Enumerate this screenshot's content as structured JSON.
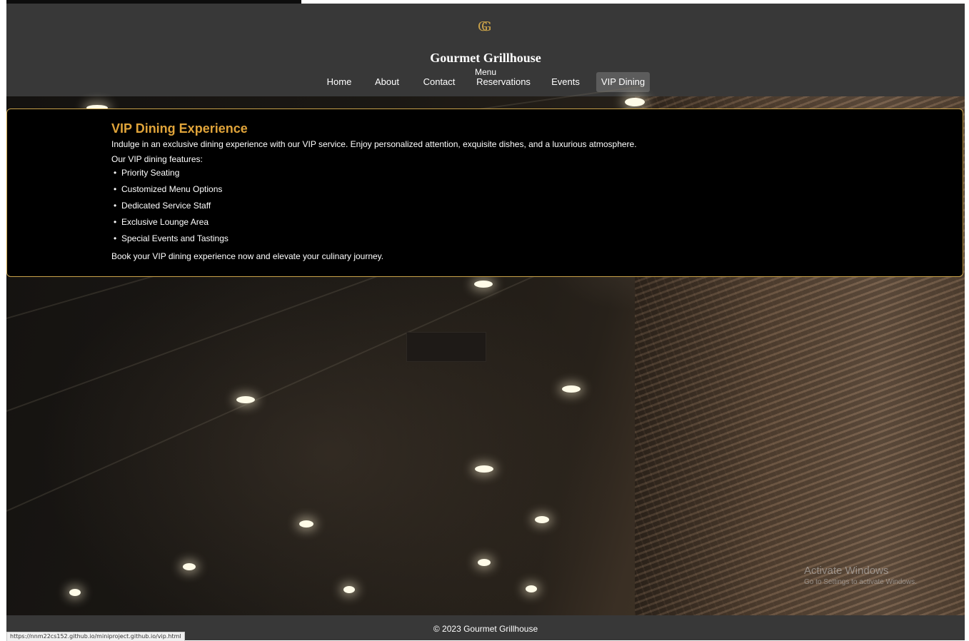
{
  "header": {
    "logo_glyph": "G",
    "brand": "Gourmet Grillhouse",
    "menu_label": "Menu"
  },
  "nav": {
    "items": [
      {
        "label": "Home"
      },
      {
        "label": "About"
      },
      {
        "label": "Contact"
      },
      {
        "label": "Reservations"
      },
      {
        "label": "Events"
      },
      {
        "label": "VIP Dining",
        "active": true
      }
    ]
  },
  "vip": {
    "title": "VIP Dining Experience",
    "intro": "Indulge in an exclusive dining experience with our VIP service. Enjoy personalized attention, exquisite dishes, and a luxurious atmosphere.",
    "features_heading": "Our VIP dining features:",
    "features": [
      "Priority Seating",
      "Customized Menu Options",
      "Dedicated Service Staff",
      "Exclusive Lounge Area",
      "Special Events and Tastings"
    ],
    "outro": "Book your VIP dining experience now and elevate your culinary journey."
  },
  "watermark": {
    "title": "Activate Windows",
    "subtitle": "Go to Settings to activate Windows."
  },
  "footer": {
    "copyright": "© 2023 Gourmet Grillhouse"
  },
  "status_bar": {
    "url": "https://nnm22cs152.github.io/miniproject.github.io/vip.html"
  },
  "colors": {
    "accent_gold": "#e0a43a",
    "border_gold": "#c9a24a",
    "header_bg": "#383838",
    "card_bg": "#000000"
  }
}
